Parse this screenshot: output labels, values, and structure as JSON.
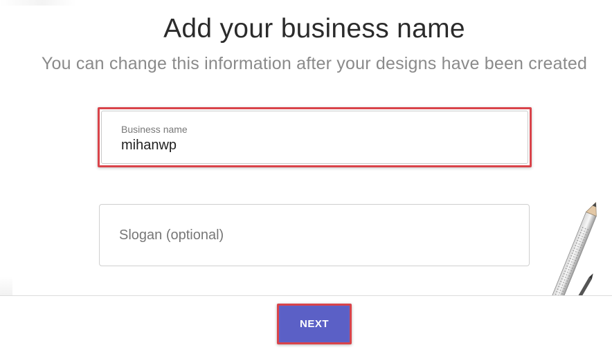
{
  "header": {
    "title": "Add your business name",
    "subtitle": "You can change this information after your designs have been created"
  },
  "form": {
    "business_name": {
      "label": "Business name",
      "value": "mihanwp"
    },
    "slogan": {
      "placeholder": "Slogan (optional)",
      "value": ""
    }
  },
  "footer": {
    "next_label": "NEXT"
  },
  "colors": {
    "accent": "#5b60c6",
    "highlight": "#d9434a",
    "title": "#2b2b2b",
    "subtitle": "#8a8a8a"
  },
  "icons": {
    "decoration": "pencil-icon"
  }
}
